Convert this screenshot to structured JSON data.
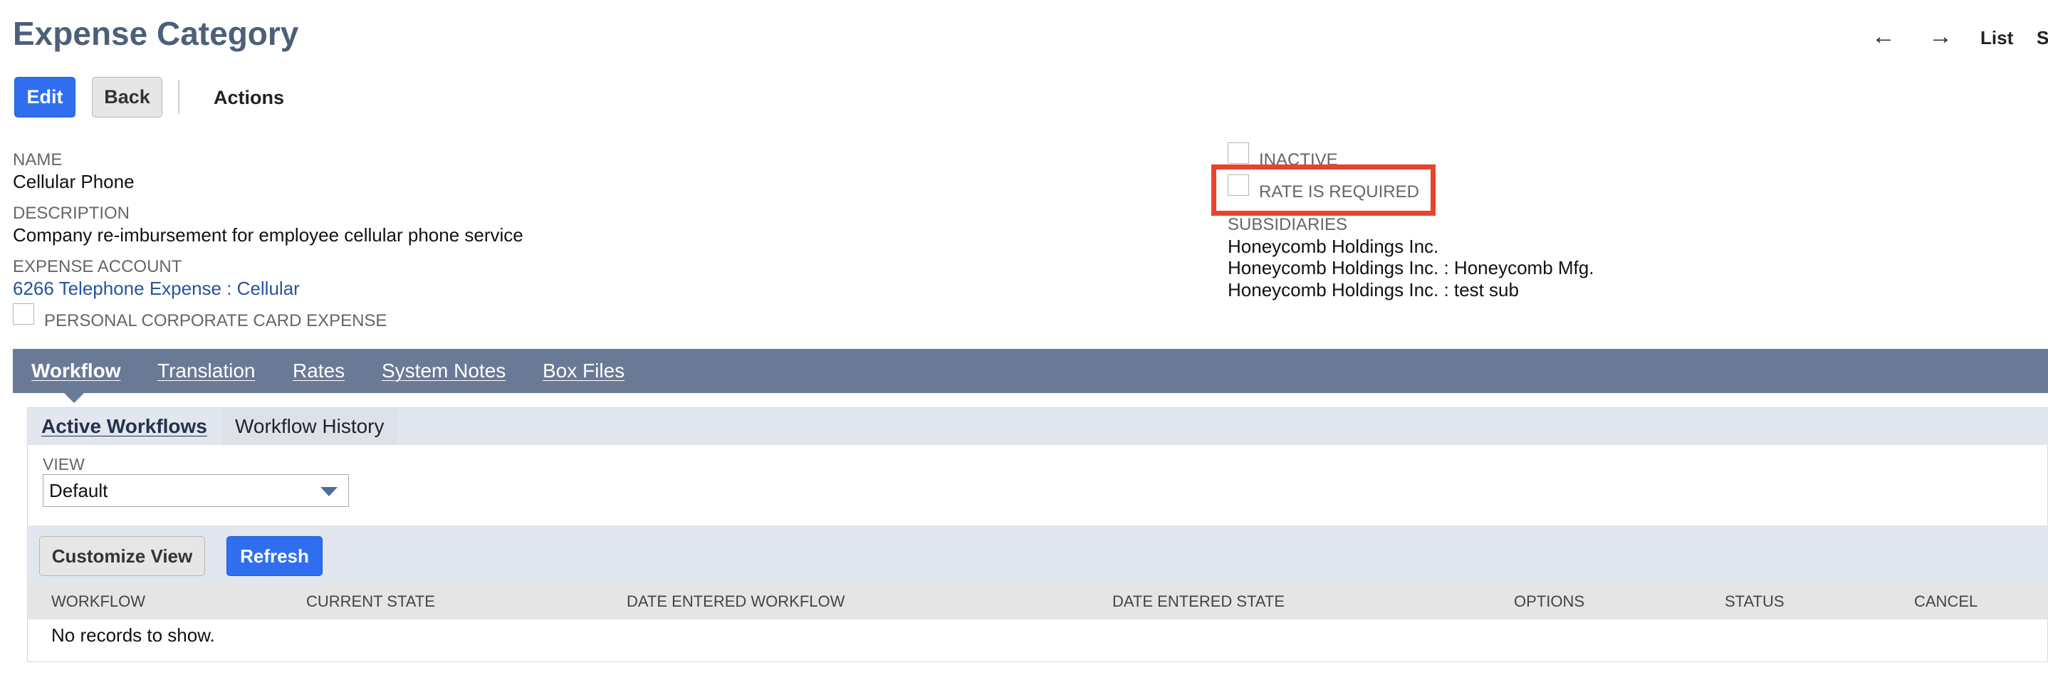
{
  "page": {
    "title": "Expense Category",
    "nav": {
      "prev_icon": "←",
      "next_icon": "→",
      "list": "List",
      "search": "S"
    }
  },
  "toolbar": {
    "edit": "Edit",
    "back": "Back",
    "actions": "Actions"
  },
  "fields": {
    "name_label": "NAME",
    "name_value": "Cellular Phone",
    "description_label": "DESCRIPTION",
    "description_value": "Company re-imbursement for employee cellular phone service",
    "expense_account_label": "EXPENSE ACCOUNT",
    "expense_account_value": "6266 Telephone Expense : Cellular",
    "personal_card_label": "PERSONAL CORPORATE CARD EXPENSE",
    "inactive_label": "INACTIVE",
    "rate_required_label": "RATE IS REQUIRED",
    "subsidiaries_label": "SUBSIDIARIES",
    "subsidiaries": [
      "Honeycomb Holdings Inc.",
      "Honeycomb Holdings Inc. : Honeycomb Mfg.",
      "Honeycomb Holdings Inc. : test sub"
    ]
  },
  "tabs": [
    {
      "label": "Workflow",
      "active": true
    },
    {
      "label": "Translation",
      "active": false
    },
    {
      "label": "Rates",
      "active": false
    },
    {
      "label": "System Notes",
      "active": false
    },
    {
      "label": "Box Files",
      "active": false
    }
  ],
  "subtabs": [
    {
      "label": "Active Workflows",
      "active": true
    },
    {
      "label": "Workflow History",
      "active": false
    }
  ],
  "view": {
    "label": "VIEW",
    "selected": "Default"
  },
  "list_buttons": {
    "customize": "Customize View",
    "refresh": "Refresh"
  },
  "table": {
    "columns": [
      "WORKFLOW",
      "CURRENT STATE",
      "DATE ENTERED WORKFLOW",
      "DATE ENTERED STATE",
      "OPTIONS",
      "STATUS",
      "CANCEL"
    ],
    "empty_text": "No records to show."
  },
  "colors": {
    "accent": "#2f6fef",
    "tabbar": "#6a7a96",
    "title": "#4d5f79",
    "highlight": "#e8432b",
    "link": "#255599"
  }
}
